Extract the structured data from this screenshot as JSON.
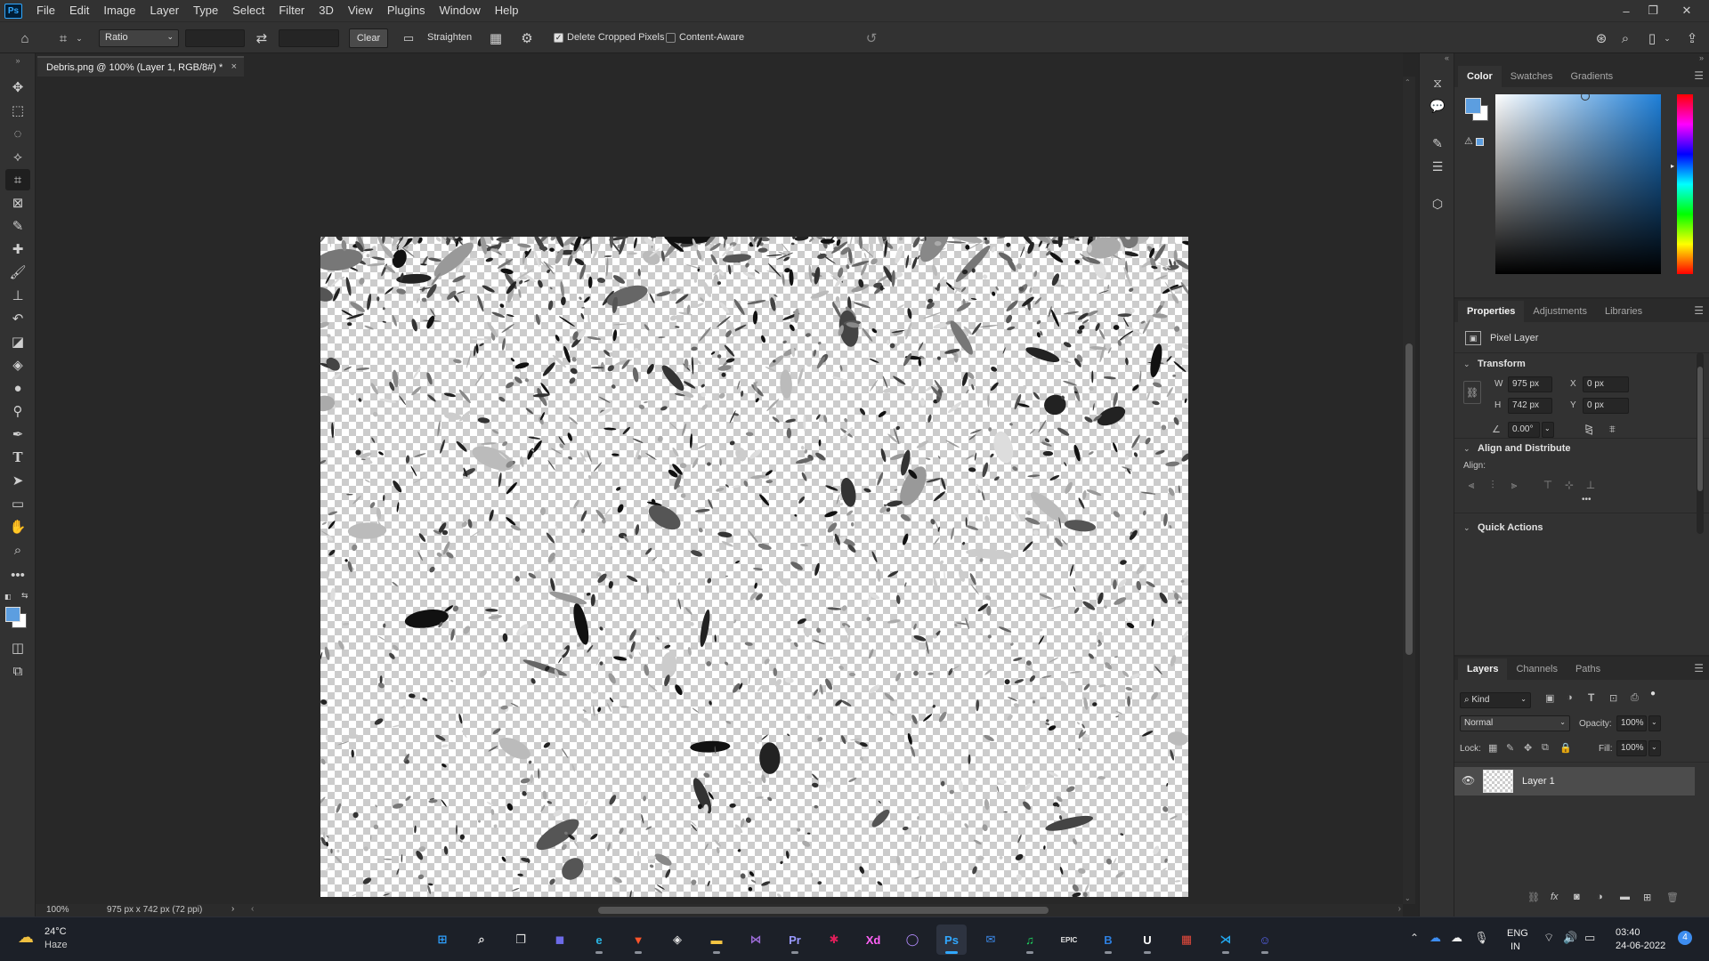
{
  "menubar": {
    "logo": "Ps",
    "items": [
      "File",
      "Edit",
      "Image",
      "Layer",
      "Type",
      "Select",
      "Filter",
      "3D",
      "View",
      "Plugins",
      "Window",
      "Help"
    ],
    "window_controls": {
      "minimize": "–",
      "restore": "❐",
      "close": "✕"
    }
  },
  "options_bar": {
    "ratio_select": "Ratio",
    "swap_icon": "⇄",
    "clear_label": "Clear",
    "straighten_label": "Straighten",
    "delete_cropped_label": "Delete Cropped Pixels",
    "delete_cropped_checked": true,
    "content_aware_label": "Content-Aware",
    "content_aware_checked": false
  },
  "document": {
    "tab_title": "Debris.png @ 100% (Layer 1, RGB/8#) *",
    "tab_close": "×",
    "zoom": "100%",
    "doc_info": "975 px x 742 px (72 ppi)"
  },
  "color_panel": {
    "tabs": [
      "Color",
      "Swatches",
      "Gradients"
    ],
    "active_tab": "Color",
    "foreground": "#5c9ee0",
    "background": "#ffffff",
    "field_hue": "#1e7fd8"
  },
  "properties_panel": {
    "tabs": [
      "Properties",
      "Adjustments",
      "Libraries"
    ],
    "active_tab": "Properties",
    "layer_type": "Pixel Layer",
    "transform": {
      "title": "Transform",
      "w_label": "W",
      "w": "975 px",
      "h_label": "H",
      "h": "742 px",
      "x_label": "X",
      "x": "0 px",
      "y_label": "Y",
      "y": "0 px",
      "angle": "0.00°"
    },
    "align": {
      "title": "Align and Distribute",
      "label": "Align:",
      "more": "•••"
    },
    "quick_actions": "Quick Actions"
  },
  "layers_panel": {
    "tabs": [
      "Layers",
      "Channels",
      "Paths"
    ],
    "active_tab": "Layers",
    "filter_kind": "Kind",
    "blend_mode": "Normal",
    "opacity_label": "Opacity:",
    "opacity": "100%",
    "lock_label": "Lock:",
    "fill_label": "Fill:",
    "fill": "100%",
    "layers": [
      {
        "name": "Layer 1",
        "visible": true
      }
    ]
  },
  "taskbar": {
    "weather_temp": "24°C",
    "weather_desc": "Haze",
    "lang_line1": "ENG",
    "lang_line2": "IN",
    "time": "03:40",
    "date": "24-06-2022",
    "notification_count": "4",
    "apps": [
      {
        "name": "windows-start",
        "label": "⊞",
        "color": "#2ea0ff"
      },
      {
        "name": "search",
        "label": "⌕",
        "color": "#e6e6e6"
      },
      {
        "name": "task-view",
        "label": "❐",
        "color": "#e6e6e6"
      },
      {
        "name": "teams-chat",
        "label": "◼",
        "color": "#6d6be8"
      },
      {
        "name": "edge",
        "label": "e",
        "color": "#2bb6e5"
      },
      {
        "name": "brave",
        "label": "▼",
        "color": "#fb542b"
      },
      {
        "name": "unity",
        "label": "◈",
        "color": "#e6e6e6"
      },
      {
        "name": "file-explorer",
        "label": "▬",
        "color": "#f5c542"
      },
      {
        "name": "visual-studio",
        "label": "⋈",
        "color": "#9b6bd6"
      },
      {
        "name": "premiere-pro",
        "label": "Pr",
        "color": "#9999ff"
      },
      {
        "name": "slack",
        "label": "✱",
        "color": "#e01e5a"
      },
      {
        "name": "adobe-xd",
        "label": "Xd",
        "color": "#ff61f6"
      },
      {
        "name": "github-desktop",
        "label": "◯",
        "color": "#b48cff"
      },
      {
        "name": "photoshop",
        "label": "Ps",
        "color": "#31a8ff"
      },
      {
        "name": "mail",
        "label": "✉",
        "color": "#3d8df0"
      },
      {
        "name": "spotify",
        "label": "♫",
        "color": "#1ed760"
      },
      {
        "name": "epic-games",
        "label": "EPIC",
        "color": "#e6e6e6"
      },
      {
        "name": "bitwarden",
        "label": "B",
        "color": "#2d7fe0"
      },
      {
        "name": "unreal-engine",
        "label": "U",
        "color": "#ffffff"
      },
      {
        "name": "paint-app",
        "label": "▦",
        "color": "#e84a3c"
      },
      {
        "name": "vscode",
        "label": "⋊",
        "color": "#23a9f2"
      },
      {
        "name": "discord",
        "label": "☺",
        "color": "#5865f2"
      }
    ]
  }
}
